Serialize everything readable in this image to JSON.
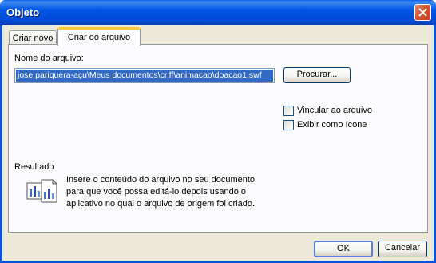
{
  "window": {
    "title": "Objeto"
  },
  "tabs": [
    {
      "label": "Criar novo",
      "active": false
    },
    {
      "label": "Criar do arquivo",
      "active": true
    }
  ],
  "file": {
    "label": "Nome do arquivo:",
    "value": "jose pariquera-açu\\Meus documentos\\criff\\animacao\\doacao1.swf",
    "browse_label": "Procurar..."
  },
  "options": {
    "link_label": "Vincular ao arquivo",
    "link_checked": false,
    "icon_label": "Exibir como ícone",
    "icon_checked": false
  },
  "result": {
    "heading": "Resultado",
    "line1": "Insere o conteúdo do arquivo no seu documento",
    "line2": "para que você possa editá-lo depois usando o",
    "line3": "aplicativo no qual o arquivo de origem foi criado."
  },
  "buttons": {
    "ok": "OK",
    "cancel": "Cancelar"
  }
}
